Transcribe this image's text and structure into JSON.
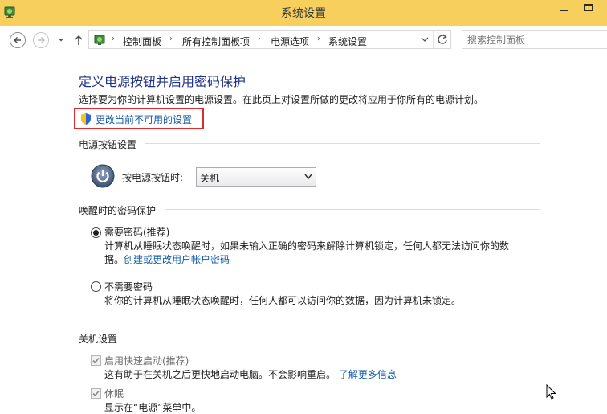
{
  "window": {
    "title": "系统设置"
  },
  "nav": {
    "breadcrumbs": [
      "控制面板",
      "所有控制面板项",
      "电源选项",
      "系统设置"
    ],
    "search_placeholder": "搜索控制面板"
  },
  "page": {
    "title": "定义电源按钮并启用密码保护",
    "description": "选择要为你的计算机设置的电源设置。在此页上对设置所做的更改将应用于你所有的电源计划。",
    "change_link": "更改当前不可用的设置"
  },
  "power_button_section": {
    "heading": "电源按钮设置",
    "label": "按电源按钮时:",
    "selected_value": "关机"
  },
  "wake_password_section": {
    "heading": "唤醒时的密码保护",
    "option_require": {
      "label": "需要密码(推荐)",
      "desc_line1": "计算机从睡眠状态唤醒时，如果未输入正确的密码来解除计算机锁定，任何人都无法访问你的数",
      "desc_line2_prefix": "据。",
      "desc_link": "创建或更改用户帐户密码",
      "selected": true
    },
    "option_no_require": {
      "label": "不需要密码",
      "desc": "将你的计算机从睡眠状态唤醒时，任何人都可以访问你的数据，因为计算机未锁定。",
      "selected": false
    }
  },
  "shutdown_section": {
    "heading": "关机设置",
    "fast_startup": {
      "label": "启用快速启动(推荐)",
      "desc": "这有助于在关机之后更快地启动电脑。不会影响重启。",
      "link": "了解更多信息",
      "checked": true
    },
    "hibernate": {
      "label": "休眠",
      "desc": "显示在“电源”菜单中。",
      "checked": true
    }
  },
  "colors": {
    "titlebar": "#f6cf5c",
    "title_text": "#1e3287",
    "link": "#0f5aa8",
    "highlight_box": "#e02b2b"
  }
}
